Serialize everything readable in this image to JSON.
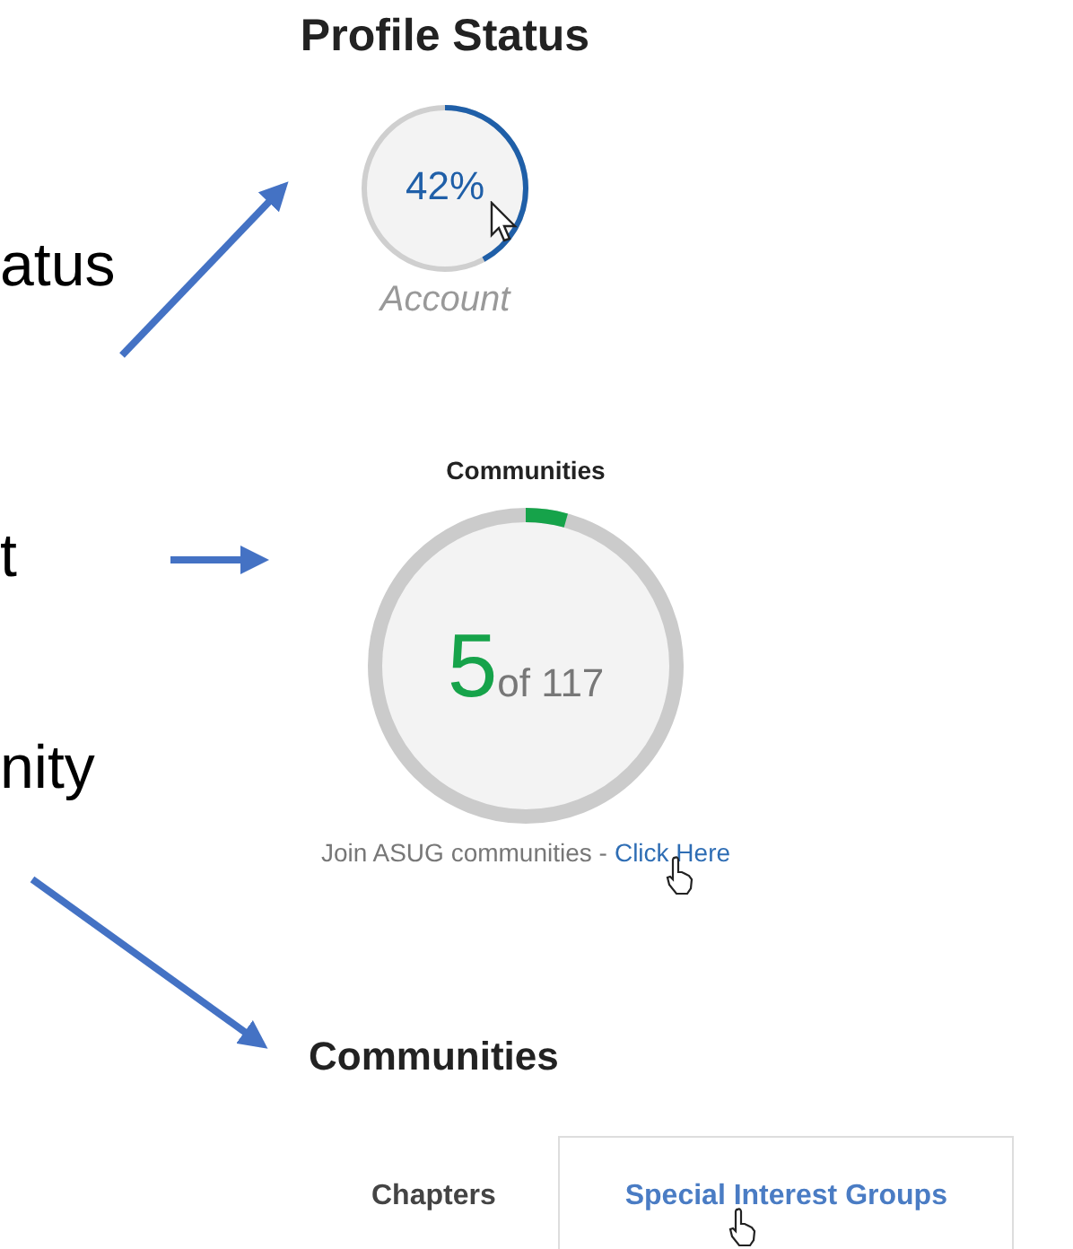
{
  "annotations": [
    {
      "text": "atus"
    },
    {
      "text": "t"
    },
    {
      "text": "nity"
    }
  ],
  "profile_status": {
    "title": "Profile Status",
    "value": "42%",
    "level": 0.42,
    "label": "Account"
  },
  "communities_widget": {
    "title": "Communities",
    "count": "5",
    "total": "of 117",
    "level": 0.043,
    "prompt": "Join ASUG communities -",
    "link": "Click Here"
  },
  "communities_section": {
    "title": "Communities",
    "tabs": [
      {
        "label": "Chapters",
        "selected": false
      },
      {
        "label": "Special Interest Groups",
        "selected": true
      }
    ]
  }
}
